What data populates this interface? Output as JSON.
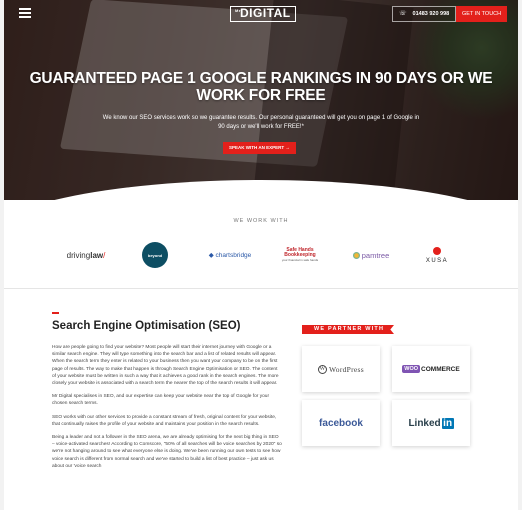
{
  "header": {
    "logo_text": "DIGITAL",
    "logo_prefix": "Mr",
    "phone": "01483 920 998",
    "cta": "GET IN TOUCH"
  },
  "hero": {
    "title": "GUARANTEED PAGE 1 GOOGLE RANKINGS IN 90 DAYS OR WE WORK FOR FREE",
    "subtitle": "We know our SEO services work so we guarantee results. Our personal guaranteed will get you on page 1 of Google in 90 days or we'll work for FREE!*",
    "button": "SPEAK WITH AN EXPERT →"
  },
  "clients": {
    "title": "WE WORK WITH",
    "items": {
      "driving_a": "driving",
      "driving_b": "law",
      "beyond": "beyond",
      "charts": "chartsbridge",
      "safe_a": "Safe Hands",
      "safe_b": "Bookkeeping",
      "safe_c": "your financial in safe hands",
      "pam": "pamtree",
      "xusa": "XUSA"
    }
  },
  "seo": {
    "heading": "Search Engine Optimisation (SEO)",
    "p1": "How are people going to find your website? Most people will start their internet journey with Google or a similar search engine. They will type something into the search bar and a list of related results will appear. When the search term they enter is related to your business then you want your company to be on the first page of results. The way to make that happen is through Search Engine Optimisation or SEO. The content of your website must be written in such a way that it achieves a good rank in the search engines. The more closely your website is associated with a search term the nearer the top of the search results it will appear.",
    "p2": "Mr Digital specialises in SEO, and our expertise can keep your website near the top of Google for your chosen search terms.",
    "p3": "SEO works with our other services to provide a constant stream of fresh, original content for your website, that continually raises the profile of your website and maintains your position in the search results.",
    "p4": "Being a leader and not a follower in the SEO arena, we are already optimising for the next big thing in SEO – voice-activated searches! According to Comscore, \"50% of all searches will be voice searches by 2020\" so we're not hanging around to see what everyone else is doing. We've been running our own tests to see how voice search is different from normal search and we've started to build a list of best practice – just ask us about our 'voice search"
  },
  "partners": {
    "title": "WE PARTNER WITH",
    "wordpress": "WordPress",
    "woo_a": "WOO",
    "woo_b": "COMMERCE",
    "facebook": "facebook",
    "linkedin_a": "Linked",
    "linkedin_b": "in"
  }
}
